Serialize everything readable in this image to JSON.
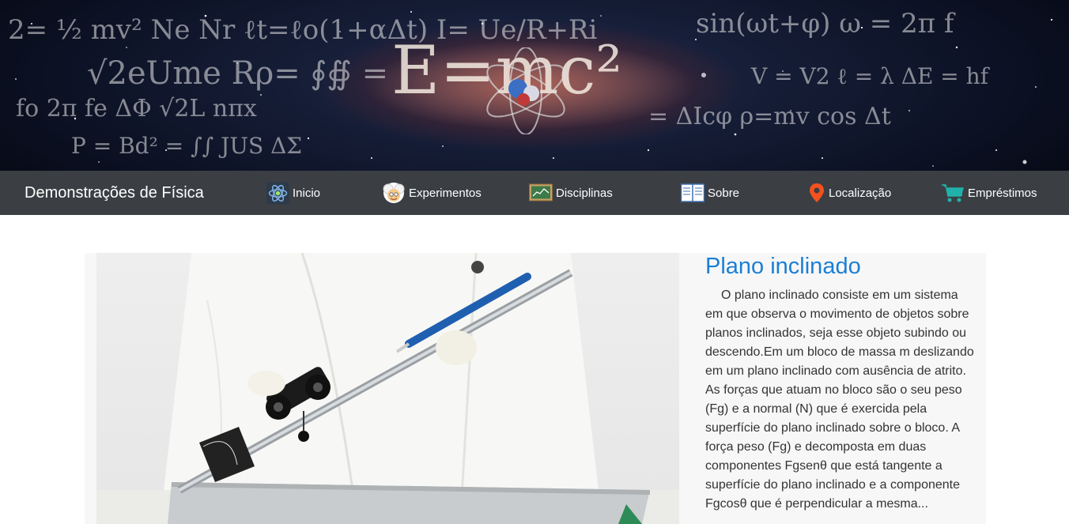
{
  "navbar": {
    "brand": "Demonstrações de Física",
    "items": [
      {
        "label": "Inicio",
        "icon": "atom-icon"
      },
      {
        "label": "Experimentos",
        "icon": "scientist-icon"
      },
      {
        "label": "Disciplinas",
        "icon": "chart-board-icon"
      },
      {
        "label": "Sobre",
        "icon": "open-book-icon"
      },
      {
        "label": "Localização",
        "icon": "map-pin-icon"
      },
      {
        "label": "Empréstimos",
        "icon": "shopping-cart-icon"
      }
    ]
  },
  "banner": {
    "formula_main": "E=mc²"
  },
  "card": {
    "title": "Plano inclinado",
    "text": "O plano inclinado consiste em um sistema em que observa o movimento de objetos sobre planos inclinados, seja esse objeto subindo ou descendo.Em um bloco de massa m deslizando em um plano inclinado com ausência de atrito. As forças que atuam no bloco são o seu peso (Fg) e a normal (N) que é exercida pela superfície do plano inclinado sobre o bloco. A força peso (Fg) e decomposta em duas componentes Fgsenθ que está tangente a superfície do plano inclinado e a componente Fgcosθ que é perpendicular a mesma..."
  },
  "colors": {
    "navbar_bg": "#3b3f44",
    "title_blue": "#1a7fd6",
    "card_bg": "#f7f7f7"
  }
}
